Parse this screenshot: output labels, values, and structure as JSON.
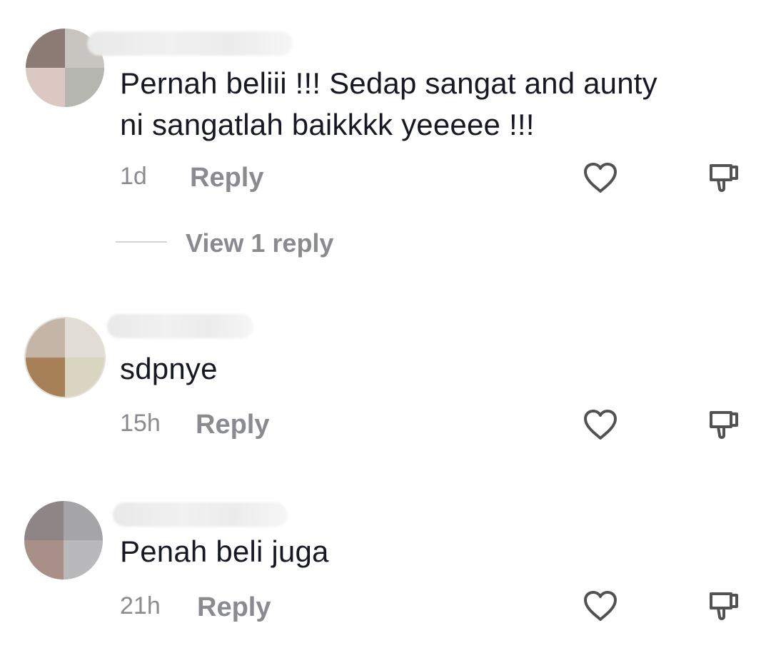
{
  "comments": [
    {
      "text": "Pernah beliii !!! Sedap sangat and aunty\nni sangatlah baikkkk yeeeee !!!",
      "time": "1d",
      "reply_label": "Reply",
      "view_replies_label": "View 1 reply",
      "avatar_colors": [
        "#8b7b74",
        "#c8c4bf",
        "#dcc8c2",
        "#b6b6b0"
      ]
    },
    {
      "text": "sdpnye",
      "time": "15h",
      "reply_label": "Reply",
      "avatar_colors": [
        "#c4b5a6",
        "#e1ddd6",
        "#a88058",
        "#d9d5c0"
      ]
    },
    {
      "text": "Penah beli juga",
      "time": "21h",
      "reply_label": "Reply",
      "avatar_colors": [
        "#8f8586",
        "#a5a4a6",
        "#a89088",
        "#b9b8bb"
      ]
    }
  ],
  "icons": {
    "like": "heart-outline-icon",
    "dislike": "thumbs-down-outline-icon"
  },
  "colors": {
    "primary_text": "#161823",
    "secondary_text": "#8a8b91",
    "icon": "#525252"
  }
}
